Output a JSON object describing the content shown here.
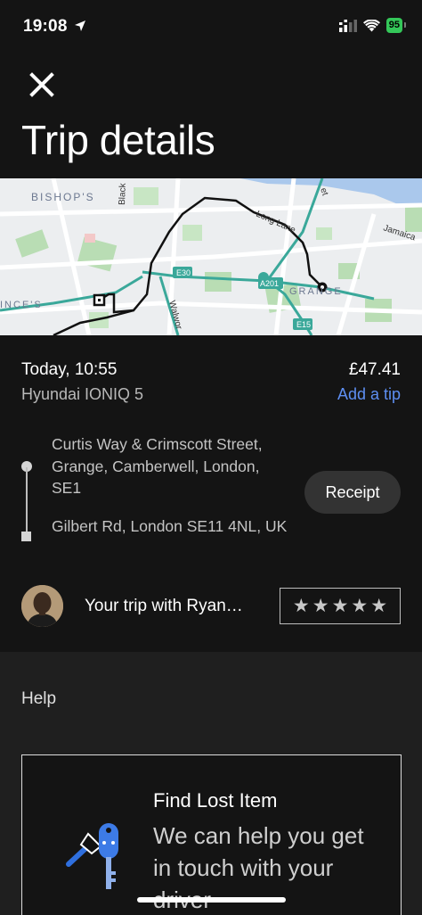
{
  "status_bar": {
    "time": "19:08",
    "battery": "95"
  },
  "header": {
    "title": "Trip details"
  },
  "map": {
    "labels": {
      "bishops": "BISHOP'S",
      "blackfriars": "Black",
      "et": "et",
      "long_lane": "Long Lane",
      "jamaica": "Jamaica",
      "e30": "E30",
      "a201": "A201",
      "grange": "GRANGE",
      "ince": "INCE'S",
      "walworth": "Walwor",
      "e15": "E15"
    }
  },
  "trip": {
    "date": "Today, 10:55",
    "vehicle": "Hyundai IONIQ 5",
    "fare": "£47.41",
    "add_tip": "Add a tip",
    "pickup": "Curtis Way & Crimscott Street, Grange, Camberwell, London, SE1",
    "dropoff": "Gilbert Rd, London SE11 4NL, UK",
    "receipt_label": "Receipt",
    "driver_text": "Your trip with Ryan…",
    "stars": [
      "★",
      "★",
      "★",
      "★",
      "★"
    ]
  },
  "help": {
    "title": "Help",
    "card_title": "Find Lost Item",
    "card_body": "We can help you get in touch with your driver"
  },
  "colors": {
    "tip_link": "#5e8ff3",
    "route_teal": "#3aa89a",
    "map_bg": "#eceef0"
  }
}
